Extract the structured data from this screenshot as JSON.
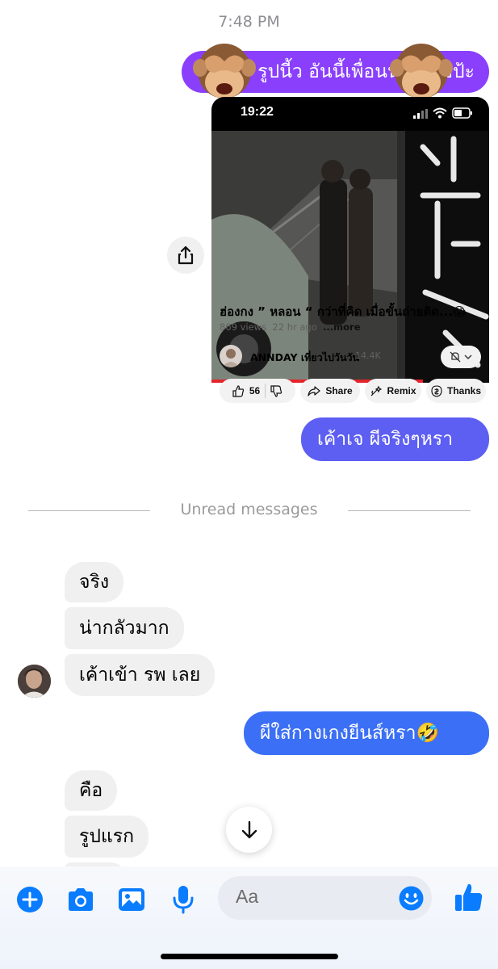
{
  "header": {
    "timestamp": "7:48 PM"
  },
  "messages": {
    "out_1": {
      "text": "รูปนี้ว อันนี้เพื่อนน้องถ่ายป้ะ",
      "color": "#8a3ffc"
    },
    "out_2": {
      "text": "เค้าเจ ผีจริงๆหรา",
      "color": "#5d5ff2"
    },
    "out_3": {
      "text": "ผีใส่กางเกงยีนส์หรา🤣",
      "color": "#3b6ff5"
    },
    "in_1": {
      "text": "จริง"
    },
    "in_2": {
      "text": "น่ากลัวมาก"
    },
    "in_3": {
      "text": "เค้าเข้า รพ เลย"
    },
    "in_4": {
      "text": "คือ"
    },
    "in_5": {
      "text": "รูปแรก"
    }
  },
  "shared_card": {
    "phone_time": "19:22",
    "video_title": "ฮ่องกง ” หลอน “ กว่าที่คิด เมื่อขั้นถ่ายติด...😱",
    "views": "869 views",
    "age": "22 hr ago",
    "more_label": "...more",
    "channel_name": "ANNDAY เที่ยวไปวันวัน",
    "subscribers": "14.4K",
    "likes": "56",
    "actions": {
      "share": "Share",
      "remix": "Remix",
      "thanks": "Thanks"
    }
  },
  "divider": {
    "label": "Unread messages"
  },
  "composer": {
    "placeholder": "Aa",
    "icons": [
      "plus-icon",
      "camera-icon",
      "image-icon",
      "microphone-icon",
      "emoji-icon",
      "thumbs-up-icon"
    ],
    "accent": "#0a7cff"
  }
}
